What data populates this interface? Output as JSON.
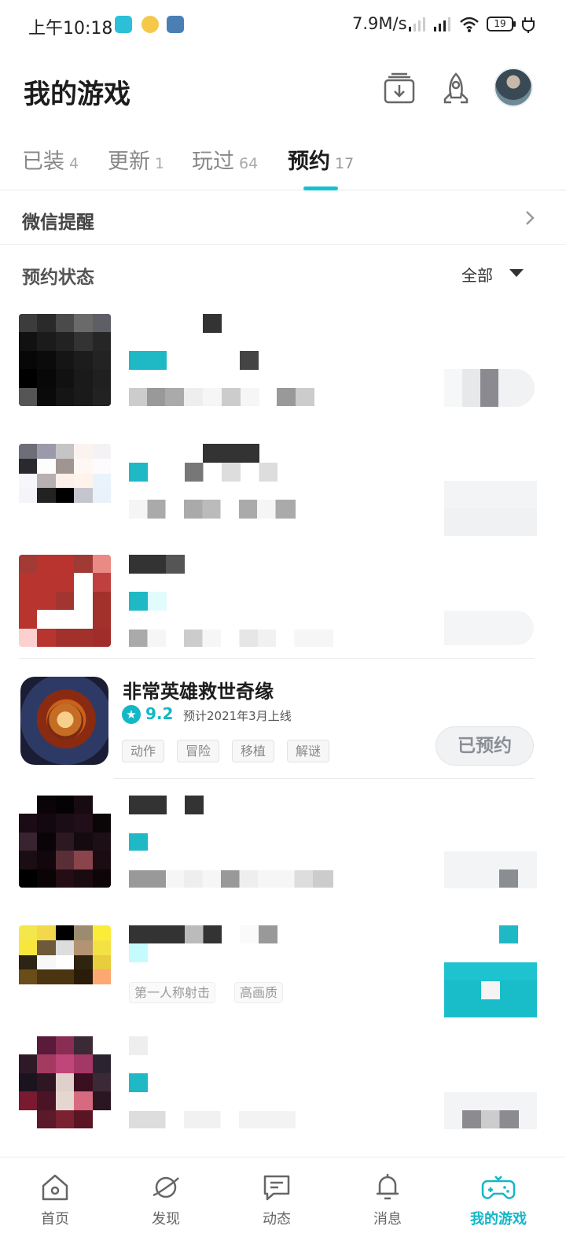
{
  "status_bar": {
    "time": "上午10:18",
    "speed": "7.9M/s",
    "battery": "19"
  },
  "header": {
    "title": "我的游戏",
    "icons": [
      "download-icon",
      "rocket-icon",
      "avatar"
    ]
  },
  "tabs": [
    {
      "label": "已装",
      "count": "4"
    },
    {
      "label": "更新",
      "count": "1"
    },
    {
      "label": "玩过",
      "count": "64"
    },
    {
      "label": "预约",
      "count": "17",
      "active": true
    }
  ],
  "wechat_reminder": {
    "label": "微信提醒"
  },
  "filter": {
    "label": "预约状态",
    "value": "全部"
  },
  "featured_game": {
    "name": "非常英雄救世奇缘",
    "score": "9.2",
    "release": "预计2021年3月上线",
    "tags": [
      "动作",
      "冒险",
      "移植",
      "解谜"
    ],
    "action": "已预约"
  },
  "blurred_tags": [
    "第一人称射击",
    "高画质"
  ],
  "bottom_nav": [
    {
      "label": "首页",
      "icon": "home-icon"
    },
    {
      "label": "发现",
      "icon": "planet-icon"
    },
    {
      "label": "动态",
      "icon": "chat-icon"
    },
    {
      "label": "消息",
      "icon": "bell-icon"
    },
    {
      "label": "我的游戏",
      "icon": "gamepad-icon",
      "active": true
    }
  ],
  "colors": {
    "accent": "#14c1cf"
  }
}
